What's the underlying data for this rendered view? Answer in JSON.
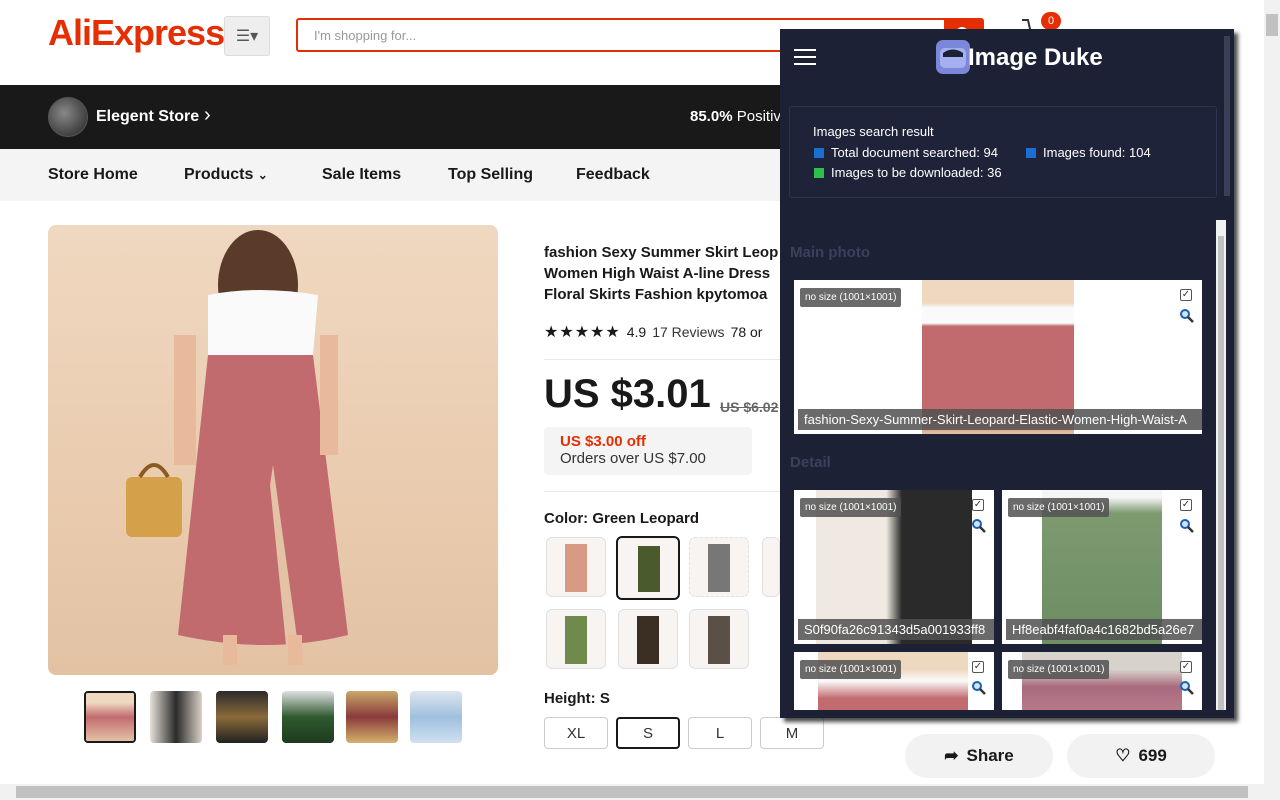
{
  "header": {
    "logo": "AliExpress",
    "logo_mark": "™",
    "search_placeholder": "I'm shopping for...",
    "cart_count": "0",
    "accent": "#e62e04"
  },
  "store": {
    "name": "Elegent Store",
    "positive_value": "85.0%",
    "positive_text": "Positiv",
    "bar_color": "#191919"
  },
  "store_nav": [
    "Store Home",
    "Products",
    "Sale Items",
    "Top Selling",
    "Feedback"
  ],
  "product": {
    "title_lines": [
      "fashion Sexy Summer Skirt Leop",
      "Women High Waist A-line Dress",
      "Floral Skirts Fashion kpytomoa"
    ],
    "rating": "4.9",
    "reviews": "17 Reviews",
    "orders": "78 or",
    "price": "US $3.01",
    "old_price": "US $6.02",
    "coupon_off": "US $3.00 off",
    "coupon_condition": "Orders over US $7.00",
    "color_label": "Color: Green Leopard",
    "height_label": "Height: S",
    "sizes": [
      "XL",
      "S",
      "L",
      "M"
    ],
    "selected_size": "S",
    "share_label": "Share",
    "likes": "699"
  },
  "image_duke": {
    "title": "Image Duke",
    "result_title": "Images search result",
    "total_documents": "Total document searched: 94",
    "images_found": "Images found: 104",
    "to_download": "Images to be downloaded: 36",
    "section_main": "Main photo",
    "section_detail": "Detail",
    "main_card": {
      "size": "no size (1001×1001)",
      "name": "fashion-Sexy-Summer-Skirt-Leopard-Elastic-Women-High-Waist-A"
    },
    "detail_cards": [
      {
        "size": "no size (1001×1001)",
        "name": "S0f90fa26c91343d5a001933ff8"
      },
      {
        "size": "no size (1001×1001)",
        "name": "Hf8eabf4faf0a4c1682bd5a26e7"
      },
      {
        "size": "no size (1001×1001)",
        "name": ""
      },
      {
        "size": "no size (1001×1001)",
        "name": ""
      }
    ],
    "colors": {
      "blue": "#1b6fd1",
      "green": "#2fbf4a",
      "panel": "#1d2136"
    }
  }
}
